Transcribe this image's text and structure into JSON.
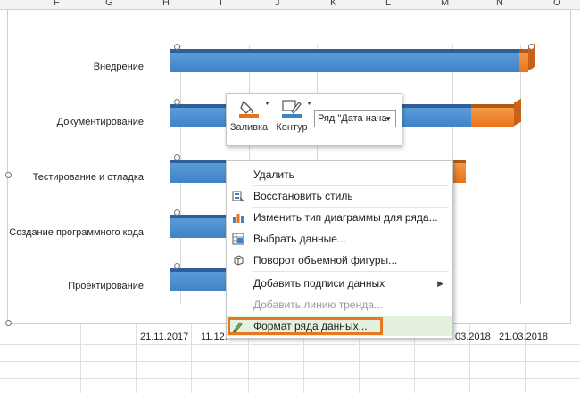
{
  "sheet": {
    "columns": [
      "F",
      "G",
      "H",
      "I",
      "J",
      "K",
      "L",
      "M",
      "N",
      "O"
    ]
  },
  "chart_data": {
    "type": "bar",
    "orientation": "horizontal",
    "categories": [
      "Внедрение",
      "Документирование",
      "Тестирование и отладка",
      "Создание программного кода",
      "Проектирование"
    ],
    "x_tick_labels": [
      "21.11.2017",
      "11.12.",
      "03.2018",
      "21.03.2018"
    ],
    "series": [
      {
        "color": "#3e82c8"
      },
      {
        "color": "#e8731b"
      }
    ]
  },
  "mini_toolbar": {
    "fill_label": "Заливка",
    "outline_label": "Контур",
    "series_select_value": "Ряд \"Дата нача"
  },
  "context_menu": {
    "items": [
      {
        "label": "Удалить",
        "icon": "none"
      },
      {
        "label": "Восстановить стиль",
        "icon": "reset-style-icon"
      },
      {
        "label": "Изменить тип диаграммы для ряда...",
        "icon": "chart-type-icon"
      },
      {
        "label": "Выбрать данные...",
        "icon": "select-data-icon"
      },
      {
        "label": "Поворот объемной фигуры...",
        "icon": "rotate-3d-icon"
      },
      {
        "label": "Добавить подписи данных",
        "icon": "none",
        "submenu": true
      },
      {
        "label": "Добавить линию тренда...",
        "icon": "none",
        "disabled": true
      },
      {
        "label": "Формат ряда данных...",
        "icon": "format-series-icon",
        "highlighted": true
      }
    ]
  }
}
